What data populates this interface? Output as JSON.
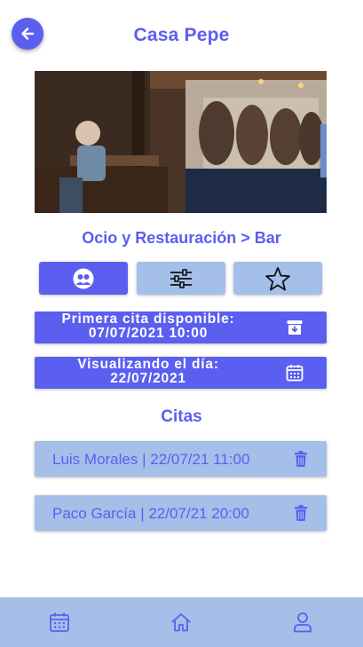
{
  "header": {
    "title": "Casa Pepe",
    "back_icon": "arrow-left-icon"
  },
  "category": "Ocio y Restauración > Bar",
  "tabs": [
    {
      "icon": "group-icon",
      "active": true
    },
    {
      "icon": "sliders-icon",
      "active": false
    },
    {
      "icon": "star-icon",
      "active": false
    }
  ],
  "first_available": {
    "label": "Primera cita disponible:",
    "value": "07/07/2021 10:00",
    "icon": "archive-download-icon"
  },
  "viewing_day": {
    "label": "Visualizando el día:",
    "value": "22/07/2021",
    "icon": "calendar-icon"
  },
  "appointments": {
    "title": "Citas",
    "items": [
      {
        "text": "Luis Morales | 22/07/21 11:00"
      },
      {
        "text": "Paco García | 22/07/21 20:00"
      }
    ]
  },
  "bottom_nav": [
    {
      "icon": "calendar-icon"
    },
    {
      "icon": "home-icon"
    },
    {
      "icon": "user-icon"
    }
  ],
  "colors": {
    "primary": "#5b5ff0",
    "secondary": "#a4bfe8",
    "background": "#ffffff"
  }
}
